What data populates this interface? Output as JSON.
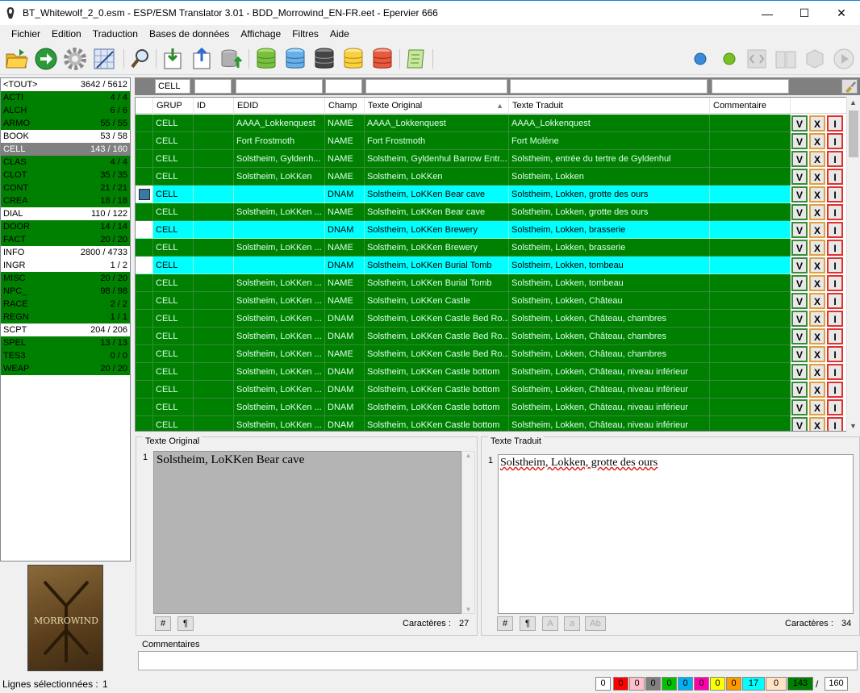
{
  "window": {
    "title": "BT_Whitewolf_2_0.esm - ESP/ESM Translator 3.01 - BDD_Morrowind_EN-FR.eet - Epervier 666",
    "minimize": "—",
    "maximize": "☐",
    "close": "✕"
  },
  "menu": [
    "Fichier",
    "Edition",
    "Traduction",
    "Bases de données",
    "Affichage",
    "Filtres",
    "Aide"
  ],
  "categories": [
    {
      "name": "<TOUT>",
      "count": "3642 / 5612",
      "state": "w"
    },
    {
      "name": "ACTI",
      "count": "4 / 4",
      "state": "g"
    },
    {
      "name": "ALCH",
      "count": "6 / 6",
      "state": "g"
    },
    {
      "name": "ARMO",
      "count": "55 / 55",
      "state": "g"
    },
    {
      "name": "BOOK",
      "count": "53 / 58",
      "state": "w"
    },
    {
      "name": "CELL",
      "count": "143 / 160",
      "state": "sel"
    },
    {
      "name": "CLAS",
      "count": "4 / 4",
      "state": "g"
    },
    {
      "name": "CLOT",
      "count": "35 / 35",
      "state": "g"
    },
    {
      "name": "CONT",
      "count": "21 / 21",
      "state": "g"
    },
    {
      "name": "CREA",
      "count": "18 / 18",
      "state": "g"
    },
    {
      "name": "DIAL",
      "count": "110 / 122",
      "state": "w"
    },
    {
      "name": "DOOR",
      "count": "14 / 14",
      "state": "g"
    },
    {
      "name": "FACT",
      "count": "20 / 20",
      "state": "g"
    },
    {
      "name": "INFO",
      "count": "2800 / 4733",
      "state": "w"
    },
    {
      "name": "INGR",
      "count": "1 / 2",
      "state": "w"
    },
    {
      "name": "MISC",
      "count": "20 / 20",
      "state": "g"
    },
    {
      "name": "NPC_",
      "count": "98 / 98",
      "state": "g"
    },
    {
      "name": "RACE",
      "count": "2 / 2",
      "state": "g"
    },
    {
      "name": "REGN",
      "count": "1 / 1",
      "state": "g"
    },
    {
      "name": "SCPT",
      "count": "204 / 206",
      "state": "w"
    },
    {
      "name": "SPEL",
      "count": "13 / 13",
      "state": "g"
    },
    {
      "name": "TES3",
      "count": "0 / 0",
      "state": "g"
    },
    {
      "name": "WEAP",
      "count": "20 / 20",
      "state": "g"
    }
  ],
  "cover_text": "MORROWIND",
  "filters": {
    "grup": "CELL"
  },
  "columns": [
    "GRUP",
    "ID",
    "EDID",
    "Champ",
    "Texte Original",
    "Texte Traduit",
    "Commentaire"
  ],
  "rows": [
    {
      "grup": "CELL",
      "id": "",
      "edid": "AAAA_Lokkenquest",
      "champ": "NAME",
      "orig": "AAAA_Lokkenquest",
      "trad": "AAAA_Lokkenquest",
      "state": "g"
    },
    {
      "grup": "CELL",
      "id": "",
      "edid": "Fort Frostmoth",
      "champ": "NAME",
      "orig": "Fort Frostmoth",
      "trad": "Fort Molène",
      "state": "g"
    },
    {
      "grup": "CELL",
      "id": "",
      "edid": "Solstheim, Gyldenh...",
      "champ": "NAME",
      "orig": "Solstheim, Gyldenhul Barrow Entr...",
      "trad": "Solstheim, entrée du tertre de Gyldenhul",
      "state": "g"
    },
    {
      "grup": "CELL",
      "id": "",
      "edid": "Solstheim, LoKKen",
      "champ": "NAME",
      "orig": "Solstheim, LoKKen",
      "trad": "Solstheim, Lokken",
      "state": "g"
    },
    {
      "grup": "CELL",
      "id": "",
      "edid": "",
      "champ": "DNAM",
      "orig": "Solstheim, LoKKen Bear cave",
      "trad": "Solstheim, Lokken, grotte des ours",
      "state": "c",
      "current": true
    },
    {
      "grup": "CELL",
      "id": "",
      "edid": "Solstheim, LoKKen ...",
      "champ": "NAME",
      "orig": "Solstheim, LoKKen Bear cave",
      "trad": "Solstheim, Lokken, grotte des ours",
      "state": "g"
    },
    {
      "grup": "CELL",
      "id": "",
      "edid": "",
      "champ": "DNAM",
      "orig": "Solstheim, LoKKen Brewery",
      "trad": "Solstheim, Lokken, brasserie",
      "state": "c"
    },
    {
      "grup": "CELL",
      "id": "",
      "edid": "Solstheim, LoKKen ...",
      "champ": "NAME",
      "orig": "Solstheim, LoKKen Brewery",
      "trad": "Solstheim, Lokken, brasserie",
      "state": "g"
    },
    {
      "grup": "CELL",
      "id": "",
      "edid": "",
      "champ": "DNAM",
      "orig": "Solstheim, LoKKen Burial Tomb",
      "trad": "Solstheim, Lokken, tombeau",
      "state": "c"
    },
    {
      "grup": "CELL",
      "id": "",
      "edid": "Solstheim, LoKKen ...",
      "champ": "NAME",
      "orig": "Solstheim, LoKKen Burial Tomb",
      "trad": "Solstheim, Lokken, tombeau",
      "state": "g"
    },
    {
      "grup": "CELL",
      "id": "",
      "edid": "Solstheim, LoKKen ...",
      "champ": "NAME",
      "orig": "Solstheim, LoKKen Castle",
      "trad": "Solstheim, Lokken, Château",
      "state": "g"
    },
    {
      "grup": "CELL",
      "id": "",
      "edid": "Solstheim, LoKKen ...",
      "champ": "DNAM",
      "orig": "Solstheim, LoKKen Castle Bed Ro...",
      "trad": "Solstheim, Lokken, Château, chambres",
      "state": "g"
    },
    {
      "grup": "CELL",
      "id": "",
      "edid": "Solstheim, LoKKen ...",
      "champ": "DNAM",
      "orig": "Solstheim, LoKKen Castle Bed Ro...",
      "trad": "Solstheim, Lokken, Château, chambres",
      "state": "g"
    },
    {
      "grup": "CELL",
      "id": "",
      "edid": "Solstheim, LoKKen ...",
      "champ": "NAME",
      "orig": "Solstheim, LoKKen Castle Bed Ro...",
      "trad": "Solstheim, Lokken, Château, chambres",
      "state": "g"
    },
    {
      "grup": "CELL",
      "id": "",
      "edid": "Solstheim, LoKKen ...",
      "champ": "DNAM",
      "orig": "Solstheim, LoKKen Castle bottom",
      "trad": "Solstheim, Lokken, Château, niveau inférieur",
      "state": "g"
    },
    {
      "grup": "CELL",
      "id": "",
      "edid": "Solstheim, LoKKen ...",
      "champ": "DNAM",
      "orig": "Solstheim, LoKKen Castle bottom",
      "trad": "Solstheim, Lokken, Château, niveau inférieur",
      "state": "g"
    },
    {
      "grup": "CELL",
      "id": "",
      "edid": "Solstheim, LoKKen ...",
      "champ": "DNAM",
      "orig": "Solstheim, LoKKen Castle bottom",
      "trad": "Solstheim, Lokken, Château, niveau inférieur",
      "state": "g"
    },
    {
      "grup": "CELL",
      "id": "",
      "edid": "Solstheim, LoKKen ...",
      "champ": "DNAM",
      "orig": "Solstheim, LoKKen Castle bottom",
      "trad": "Solstheim, Lokken, Château, niveau inférieur",
      "state": "g"
    }
  ],
  "row_buttons": {
    "v": "V",
    "x": "X",
    "i": "I"
  },
  "orig_pane": {
    "label": "Texte Original",
    "line": "1",
    "text": "Solstheim, LoKKen Bear cave",
    "chars_label": "Caractères :",
    "chars": "27",
    "btn1": "#",
    "btn2": "¶"
  },
  "trad_pane": {
    "label": "Texte Traduit",
    "line": "1",
    "text": "Solstheim, Lokken, grotte des ours",
    "chars_label": "Caractères :",
    "chars": "34",
    "btn1": "#",
    "btn2": "¶",
    "btn3": "A",
    "btn4": "a",
    "btn5": "Ab"
  },
  "comment": {
    "label": "Commentaires"
  },
  "status": {
    "label": "Lignes sélectionnées :",
    "value": "1",
    "counters": [
      {
        "v": "0",
        "bg": "#ffffff"
      },
      {
        "v": "0",
        "bg": "#ff0000"
      },
      {
        "v": "0",
        "bg": "#ffc0cb"
      },
      {
        "v": "0",
        "bg": "#808080"
      },
      {
        "v": "0",
        "bg": "#00c000"
      },
      {
        "v": "0",
        "bg": "#00b0f0"
      },
      {
        "v": "0",
        "bg": "#ff00aa"
      },
      {
        "v": "0",
        "bg": "#ffff00"
      },
      {
        "v": "0",
        "bg": "#ff9900"
      },
      {
        "v": "17",
        "bg": "#00ffff"
      },
      {
        "v": "0",
        "bg": "#ffe4c4"
      },
      {
        "v": "143",
        "bg": "#008000"
      }
    ],
    "slash": "/",
    "total": "160"
  }
}
